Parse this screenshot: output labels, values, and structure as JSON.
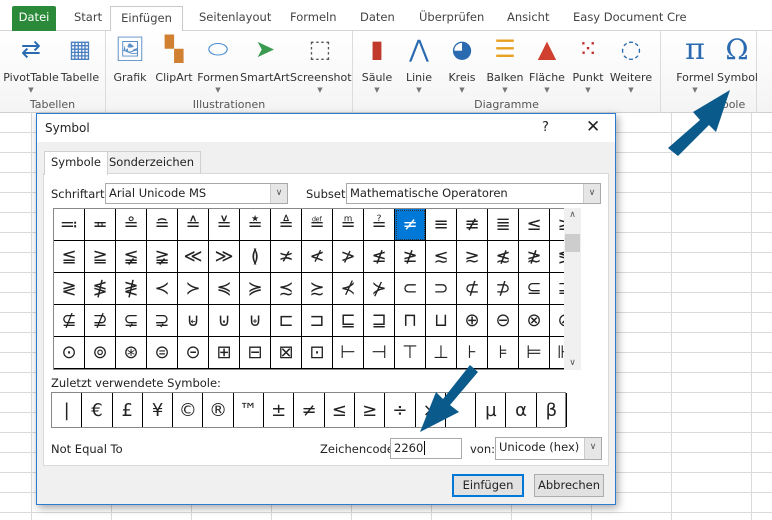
{
  "ribbon": {
    "tabs": [
      "Datei",
      "Start",
      "Einfügen",
      "Seitenlayout",
      "Formeln",
      "Daten",
      "Überprüfen",
      "Ansicht",
      "Easy Document Cre"
    ],
    "active_tab": "Einfügen",
    "groups": {
      "tabellen": {
        "label": "Tabellen",
        "buttons": [
          "PivotTable",
          "Tabelle"
        ]
      },
      "illustrationen": {
        "label": "Illustrationen",
        "buttons": [
          "Grafik",
          "ClipArt",
          "Formen",
          "SmartArt",
          "Screenshot"
        ]
      },
      "diagramme": {
        "label": "Diagramme",
        "buttons": [
          "Säule",
          "Linie",
          "Kreis",
          "Balken",
          "Fläche",
          "Punkt",
          "Weitere"
        ]
      },
      "symbole": {
        "label": "bole",
        "buttons": [
          "Formel",
          "Symbol"
        ]
      }
    }
  },
  "dialog": {
    "title": "Symbol",
    "help": "?",
    "close": "✕",
    "tabs": [
      "Symbole",
      "Sonderzeichen"
    ],
    "font_label": "Schriftart:",
    "font_value": "Arial Unicode MS",
    "subset_label": "Subset:",
    "subset_value": "Mathematische Operatoren",
    "symbols": [
      "≕",
      "≖",
      "≗",
      "≘",
      "≙",
      "≚",
      "≛",
      "≜",
      "≝",
      "≞",
      "≟",
      "≠",
      "≡",
      "≢",
      "≣",
      "≤",
      "≥",
      "≦",
      "≧",
      "≨",
      "≩",
      "≪",
      "≫",
      "≬",
      "≭",
      "≮",
      "≯",
      "≰",
      "≱",
      "≲",
      "≳",
      "≴",
      "≵",
      "≶",
      "≷",
      "≸",
      "≹",
      "≺",
      "≻",
      "≼",
      "≽",
      "≾",
      "≿",
      "⊀",
      "⊁",
      "⊂",
      "⊃",
      "⊄",
      "⊅",
      "⊆",
      "⊇",
      "⊈",
      "⊉",
      "⊊",
      "⊋",
      "⊌",
      "⊍",
      "⊎",
      "⊏",
      "⊐",
      "⊑",
      "⊒",
      "⊓",
      "⊔",
      "⊕",
      "⊖",
      "⊗",
      "⊘",
      "⊙",
      "⊚",
      "⊛",
      "⊜",
      "⊝",
      "⊞",
      "⊟",
      "⊠",
      "⊡",
      "⊢",
      "⊣",
      "⊤",
      "⊥",
      "⊦",
      "⊧",
      "⊨",
      "⊩"
    ],
    "selected_symbol": "≠",
    "recent_label": "Zuletzt verwendete Symbole:",
    "recent": [
      "|",
      "€",
      "£",
      "¥",
      "©",
      "®",
      "™",
      "±",
      "≠",
      "≤",
      "≥",
      "÷",
      "×",
      "",
      "µ",
      "α",
      "β"
    ],
    "char_name": "Not Equal To",
    "code_label": "Zeichencode:",
    "code_value": "2260",
    "from_label": "von:",
    "from_value": "Unicode (hex)",
    "insert_label": "Einfügen",
    "cancel_label": "Abbrechen"
  },
  "colors": {
    "accent": "#0078d7",
    "arrow": "#0b5a8c",
    "file_tab": "#2a8a3a"
  }
}
